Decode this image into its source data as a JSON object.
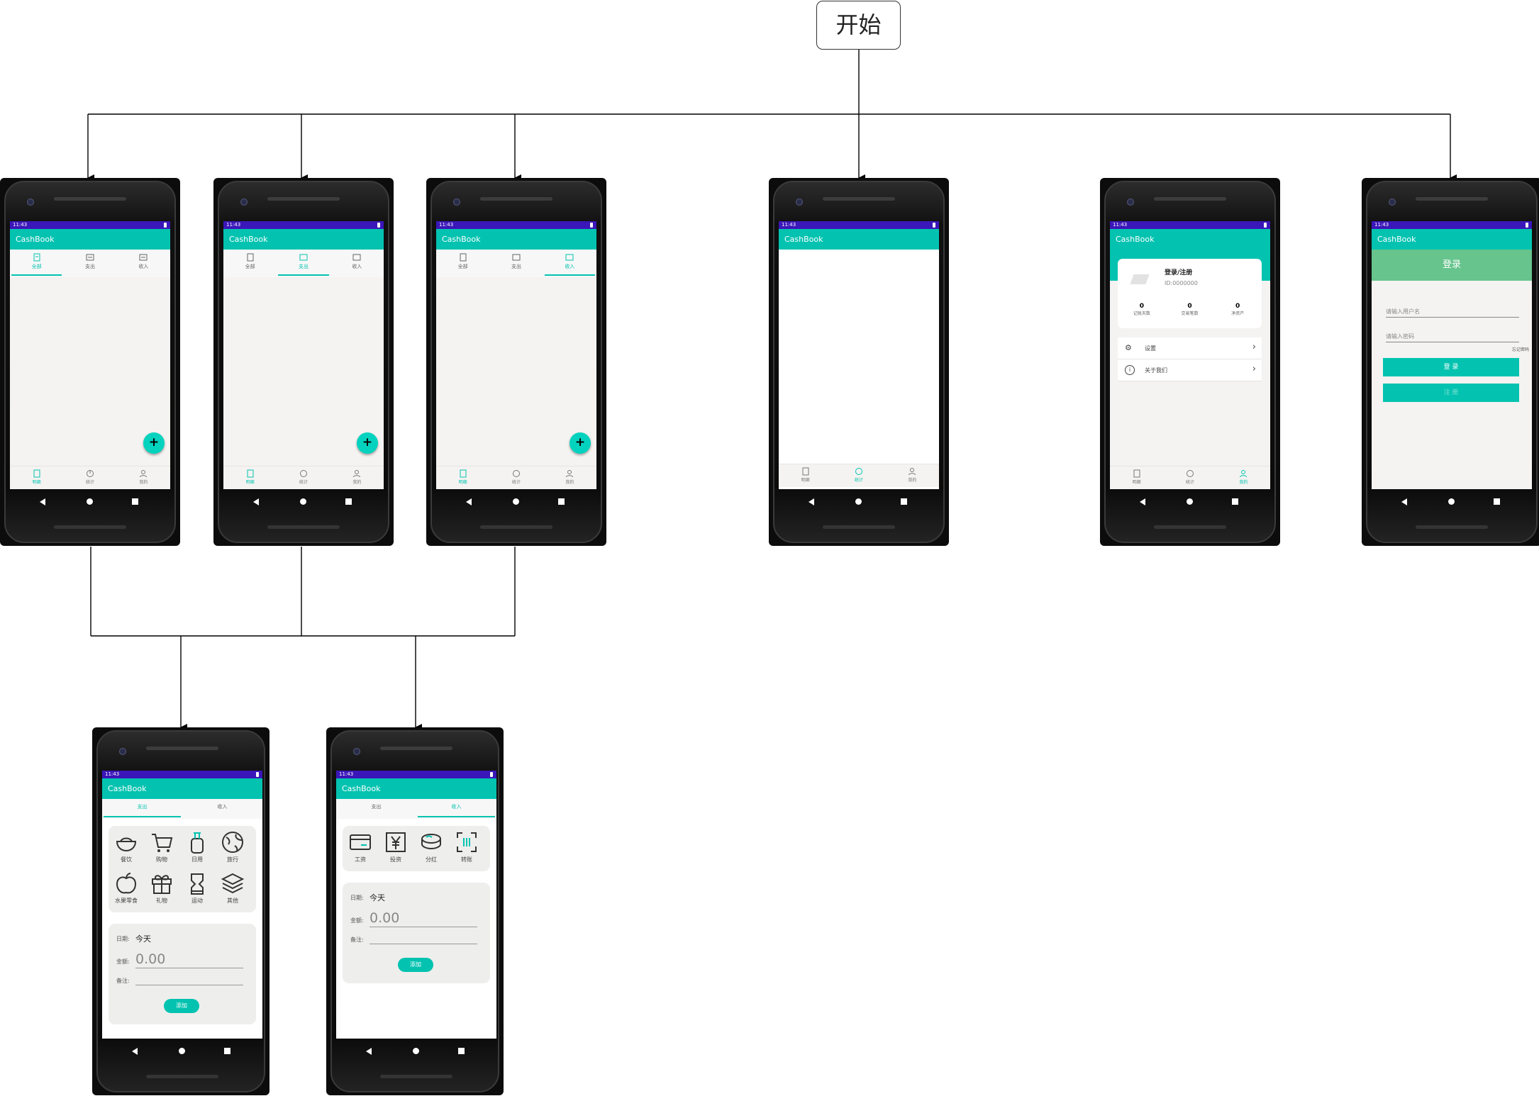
{
  "start": {
    "label": "开始"
  },
  "status_time": "11:43",
  "app_title": "CashBook",
  "colors": {
    "accent": "#03c3b0",
    "status": "#3b16b9",
    "login_header": "#66c48c"
  },
  "top_tabs": [
    "全部",
    "支出",
    "收入"
  ],
  "bottom_nav": [
    "明细",
    "统计",
    "我的"
  ],
  "fab_label": "+",
  "profile": {
    "title": "登录/注册",
    "id": "ID:0000000",
    "stats": [
      {
        "value": "0",
        "label": "记账天数"
      },
      {
        "value": "0",
        "label": "交易笔数"
      },
      {
        "value": "0",
        "label": "净资产"
      }
    ],
    "menu": [
      "设置",
      "关于我们"
    ]
  },
  "login": {
    "header": "登录",
    "username_placeholder": "请输入用户名",
    "password_placeholder": "请输入密码",
    "forgot": "忘记密码",
    "login_button": "登 录",
    "register_button": "注 册"
  },
  "add_tabs": [
    "支出",
    "收入"
  ],
  "expense_categories": [
    "餐饮",
    "购物",
    "日用",
    "旅行",
    "水果零食",
    "礼物",
    "运动",
    "其他"
  ],
  "income_categories": [
    "工资",
    "投资",
    "分红",
    "转账"
  ],
  "form": {
    "date_label": "日期:",
    "date_value": "今天",
    "amount_label": "金额:",
    "amount_value": "0.00",
    "note_label": "备注:",
    "add_button": "添加"
  }
}
